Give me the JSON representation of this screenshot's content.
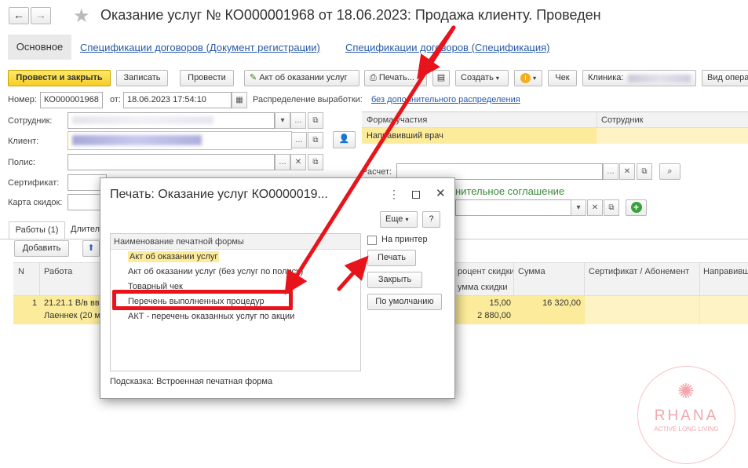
{
  "window": {
    "title": "Оказание услуг № КО000001968 от 18.06.2023: Продажа клиенту.  Проведен"
  },
  "tabs": {
    "main": "Основное",
    "link1": "Спецификации договоров (Документ регистрации)",
    "link2": "Спецификации договоров (Спецификация)"
  },
  "toolbar": {
    "post_close": "Провести и закрыть",
    "save": "Записать",
    "post": "Провести",
    "act": "Акт об оказании услуг",
    "print": "Печать...",
    "create": "Создать",
    "check": "Чек",
    "clinic_label": "Клиника:",
    "view": "Вид опера"
  },
  "form": {
    "number_label": "Номер:",
    "number": "КО000001968",
    "date_label": "от:",
    "date": "18.06.2023 17:54:10",
    "distribution_label": "Распределение выработки:",
    "distribution_value": "без дополнительного распределения",
    "employee_label": "Сотрудник:",
    "client_label": "Клиент:",
    "policy_label": "Полис:",
    "certificate_label": "Сертификат:",
    "discount_card_label": "Карта скидок:",
    "calc_label": "Расчет:",
    "agreement_label": "нительное соглашение"
  },
  "participation_table": {
    "headers": [
      "Форма участия",
      "Сотрудник"
    ],
    "rows": [
      [
        "Направивший врач",
        ""
      ]
    ]
  },
  "work_tabs": {
    "works": "Работы (1)",
    "other": "Длител"
  },
  "work_toolbar": {
    "add": "Добавить"
  },
  "works_table": {
    "headers": {
      "n": "N",
      "work": "Работа",
      "discount_pct": "роцент скидки",
      "discount_sum": "умма скидки",
      "sum": "Сумма",
      "cert": "Сертификат / Абонемент",
      "referrer": "Направивш"
    },
    "rows": [
      {
        "n": "1",
        "work_line1": "21.21.1 В/в вв",
        "work_line2": "Лаеннек (20 м",
        "discount_pct": "15,00",
        "discount_sum": "2 880,00",
        "sum": "16 320,00"
      }
    ]
  },
  "dialog": {
    "title": "Печать: Оказание услуг КО0000019...",
    "more": "Еще",
    "help": "?",
    "list_header": "Наименование печатной формы",
    "items": [
      "Акт об оказании услуг",
      "Акт об оказании услуг (без услуг по полису)",
      "Товарный чек",
      "Перечень выполненных процедур",
      "АКТ - перечень оказанных услуг по акции"
    ],
    "to_printer": "На принтер",
    "print_btn": "Печать",
    "close_btn": "Закрыть",
    "default_btn": "По умолчанию",
    "hint": "Подсказка: Встроенная печатная форма"
  },
  "watermark": {
    "brand": "RHANA",
    "tagline": "ACTIVE LONG LIVING"
  },
  "colors": {
    "accent_red": "#e8141b",
    "selection_yellow": "#fbeb9a",
    "link_blue": "#2659a8",
    "brand_pink": "#f1a7ac"
  }
}
